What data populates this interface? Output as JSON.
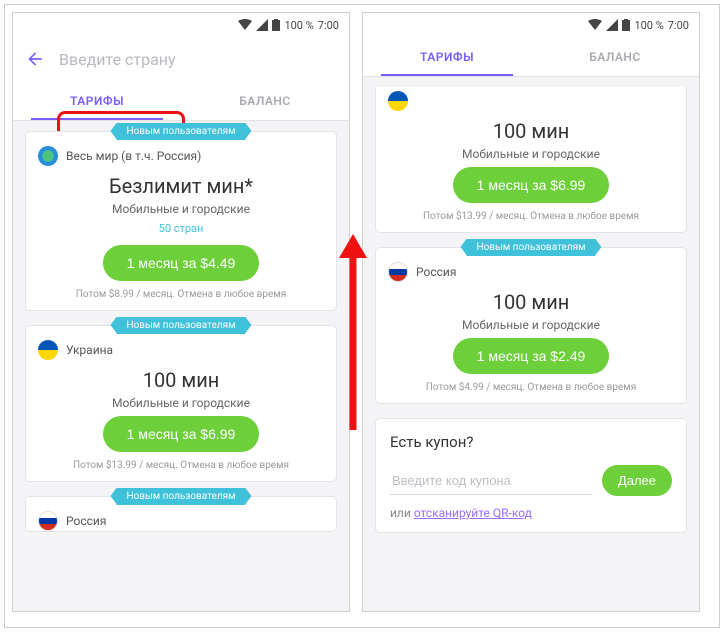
{
  "status": {
    "battery": "100 %",
    "time": "7:00"
  },
  "search_placeholder": "Введите страну",
  "tabs": {
    "tariffs": "ТАРИФЫ",
    "balance": "БАЛАНС"
  },
  "ribbon": "Новым пользователям",
  "left_cards": [
    {
      "flag": "world",
      "country": "Весь мир (в т.ч. Россия)",
      "title": "Безлимит мин*",
      "sub": "Мобильные и городские",
      "link": "50 стран",
      "button": "1 месяц за $4.49",
      "fine": "Потом $8.99 / месяц. Отмена в любое время"
    },
    {
      "flag": "ua",
      "country": "Украина",
      "title": "100 мин",
      "sub": "Мобильные и городские",
      "button": "1 месяц за $6.99",
      "fine": "Потом $13.99 / месяц. Отмена в любое время"
    },
    {
      "flag": "ru",
      "country": "Россия"
    }
  ],
  "right_top_partial": {
    "flag": "ua",
    "title": "100 мин",
    "sub": "Мобильные и городские",
    "button": "1 месяц за $6.99",
    "fine": "Потом $13.99 / месяц. Отмена в любое время"
  },
  "right_card": {
    "flag": "ru",
    "country": "Россия",
    "title": "100 мин",
    "sub": "Мобильные и городские",
    "button": "1 месяц за $2.49",
    "fine": "Потом $4.99 / месяц. Отмена в любое время"
  },
  "coupon": {
    "title": "Есть купон?",
    "placeholder": "Введите код купона",
    "next": "Далее",
    "or": "или",
    "scan": "отсканируйте QR-код"
  }
}
